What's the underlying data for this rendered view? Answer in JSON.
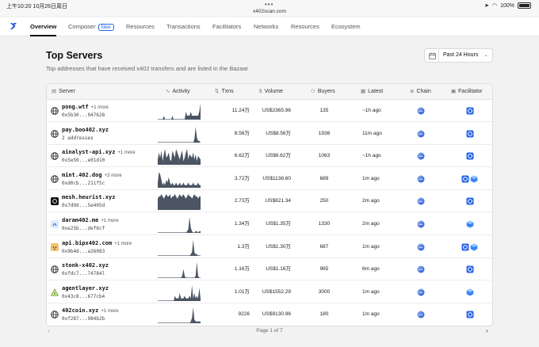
{
  "status_bar": {
    "time": "上午10:20  10月26日周日",
    "url": "x402scan.com",
    "battery": "100%"
  },
  "nav": {
    "items": [
      {
        "label": "Overview",
        "active": true
      },
      {
        "label": "Composer",
        "badge": "New"
      },
      {
        "label": "Resources"
      },
      {
        "label": "Transactions"
      },
      {
        "label": "Facilitators"
      },
      {
        "label": "Networks"
      },
      {
        "label": "Resources"
      },
      {
        "label": "Ecosystem"
      }
    ]
  },
  "header": {
    "title": "Top Servers",
    "subtitle": "Top addresses that have received x402 transfers and are listed in the Bazaar",
    "range": "Past 24 Hours"
  },
  "table": {
    "columns": [
      "Server",
      "Activity",
      "Txns",
      "Volume",
      "Buyers",
      "Latest",
      "Chain",
      "Facilitator"
    ],
    "rows": [
      {
        "name": "pong.wtf",
        "more": "+1 more",
        "addr": "0x5b30...047628",
        "txns": "11.24万",
        "volume": "US$2365.96",
        "buyers": "135",
        "latest": "~1h ago",
        "icon": "globe-icon",
        "facilitators": [
          "blue"
        ],
        "spark": [
          0,
          0,
          0,
          0,
          0,
          1,
          0,
          0,
          0,
          0,
          0,
          0,
          1,
          0,
          0,
          0,
          0,
          0,
          0,
          0,
          0,
          0,
          0,
          2,
          1,
          1,
          1,
          2,
          1,
          1,
          1,
          1,
          1,
          1,
          2,
          4
        ]
      },
      {
        "name": "pay.boo402.xyz",
        "more": "",
        "addr": "2 addresses",
        "txns": "8.56万",
        "volume": "US$8.56万",
        "buyers": "1936",
        "latest": "11m ago",
        "icon": "globe-icon",
        "facilitators": [
          "blue"
        ],
        "spark": [
          0,
          0,
          0,
          0,
          0,
          0,
          0,
          0,
          0,
          0,
          0,
          0,
          0,
          0,
          0,
          0,
          0,
          0,
          0,
          0,
          0,
          0,
          0,
          0,
          0,
          0,
          0,
          0,
          0,
          0,
          2,
          9,
          3,
          1,
          1,
          0
        ]
      },
      {
        "name": "ainalyst-api.xyz",
        "more": "+1 more",
        "addr": "0x5e50...e01d10",
        "txns": "6.62万",
        "volume": "US$6.62万",
        "buyers": "1063",
        "latest": "~1h ago",
        "icon": "globe-icon",
        "facilitators": [
          "blue"
        ],
        "spark": [
          3,
          7,
          4,
          8,
          2,
          6,
          9,
          4,
          5,
          7,
          3,
          2,
          8,
          6,
          4,
          9,
          7,
          5,
          3,
          6,
          8,
          2,
          4,
          7,
          9,
          3,
          6,
          5,
          4,
          7,
          3,
          6,
          2,
          5,
          4,
          3
        ]
      },
      {
        "name": "mint.402.dog",
        "more": "+3 more",
        "addr": "0xd0cb...211f5c",
        "txns": "3.72万",
        "volume": "US$1138.60",
        "buyers": "689",
        "latest": "1m ago",
        "icon": "globe-icon",
        "facilitators": [
          "blue",
          "cube"
        ],
        "spark": [
          2,
          6,
          5,
          3,
          1,
          2,
          1,
          3,
          2,
          4,
          2,
          1,
          2,
          1,
          1,
          2,
          1,
          1,
          2,
          1,
          1,
          2,
          1,
          1,
          1,
          2,
          1,
          1,
          1,
          2,
          1,
          1,
          1,
          2,
          1,
          1
        ]
      },
      {
        "name": "mesh.heurist.xyz",
        "more": "",
        "addr": "0x7d9d...5e405d",
        "txns": "2.73万",
        "volume": "US$821.34",
        "buyers": "250",
        "latest": "2m ago",
        "icon": "mesh-logo-icon",
        "facilitators": [
          "blue"
        ],
        "spark": [
          5,
          6,
          6,
          7,
          6,
          5,
          6,
          7,
          6,
          6,
          7,
          5,
          6,
          6,
          7,
          6,
          5,
          6,
          7,
          6,
          6,
          7,
          6,
          5,
          6,
          7,
          6,
          6,
          5,
          6,
          7,
          6,
          6,
          5,
          6,
          6
        ]
      },
      {
        "name": "daram402.me",
        "more": "+1 more",
        "addr": "0xe25b...def6cf",
        "txns": "1.34万",
        "volume": "US$1.35万",
        "buyers": "1330",
        "latest": "2m ago",
        "icon": "daram-logo-icon",
        "facilitators": [
          "cube"
        ],
        "spark": [
          0,
          0,
          0,
          0,
          0,
          0,
          0,
          0,
          0,
          0,
          0,
          0,
          0,
          0,
          0,
          0,
          0,
          0,
          0,
          0,
          0,
          0,
          0,
          0,
          1,
          2,
          9,
          3,
          1,
          0,
          0,
          1,
          1,
          0,
          1,
          1
        ]
      },
      {
        "name": "api.bipx402.com",
        "more": "+1 more",
        "addr": "0x9b4d...a26083",
        "txns": "1.3万",
        "volume": "US$1.30万",
        "buyers": "687",
        "latest": "1m ago",
        "icon": "shiba-icon",
        "facilitators": [
          "blue",
          "cube"
        ],
        "spark": [
          0,
          0,
          0,
          0,
          0,
          0,
          0,
          0,
          0,
          0,
          0,
          0,
          0,
          0,
          0,
          0,
          0,
          0,
          0,
          0,
          0,
          0,
          0,
          0,
          0,
          0,
          0,
          1,
          2,
          9,
          2,
          1,
          1,
          0,
          0,
          0
        ]
      },
      {
        "name": "stonk-x402.xyz",
        "more": "",
        "addr": "0xfdc7...74784l",
        "txns": "1.16万",
        "volume": "US$1.16万",
        "buyers": "965",
        "latest": "6m ago",
        "icon": "globe-icon",
        "facilitators": [
          "blue"
        ],
        "spark": [
          0,
          0,
          0,
          0,
          0,
          0,
          0,
          0,
          0,
          0,
          0,
          0,
          0,
          0,
          0,
          0,
          0,
          0,
          0,
          0,
          1,
          4,
          1,
          0,
          0,
          0,
          0,
          0,
          0,
          0,
          0,
          1,
          7,
          1,
          0,
          0
        ]
      },
      {
        "name": "agentlayer.xyz",
        "more": "",
        "addr": "0x43c8...677cb4",
        "txns": "1.01万",
        "volume": "US$1552.29",
        "buyers": "3000",
        "latest": "1m ago",
        "icon": "triangle-logo-icon",
        "facilitators": [
          "cube"
        ],
        "spark": [
          0,
          0,
          0,
          0,
          0,
          0,
          0,
          0,
          0,
          0,
          0,
          0,
          0,
          0,
          2,
          1,
          1,
          1,
          3,
          1,
          1,
          1,
          2,
          1,
          1,
          1,
          2,
          1,
          6,
          1,
          3,
          1,
          2,
          1,
          5,
          1
        ]
      },
      {
        "name": "402coin.xyz",
        "more": "+1 more",
        "addr": "0xf287...984b2b",
        "txns": "9226",
        "volume": "US$9130.96",
        "buyers": "180",
        "latest": "1m ago",
        "icon": "globe-icon",
        "facilitators": [
          "blue"
        ],
        "spark": [
          0,
          0,
          0,
          0,
          0,
          0,
          0,
          0,
          0,
          0,
          0,
          0,
          0,
          0,
          0,
          0,
          0,
          0,
          0,
          0,
          0,
          0,
          0,
          0,
          0,
          0,
          0,
          1,
          3,
          9,
          2,
          1,
          1,
          1,
          1,
          1
        ]
      }
    ]
  },
  "pagination": {
    "label": "Page 1 of 7",
    "prev": "‹",
    "next": "›"
  },
  "colors": {
    "chain_blue": "#3a6fd8",
    "facilitator_blue": "#2563eb",
    "spark": "#4b5563"
  }
}
